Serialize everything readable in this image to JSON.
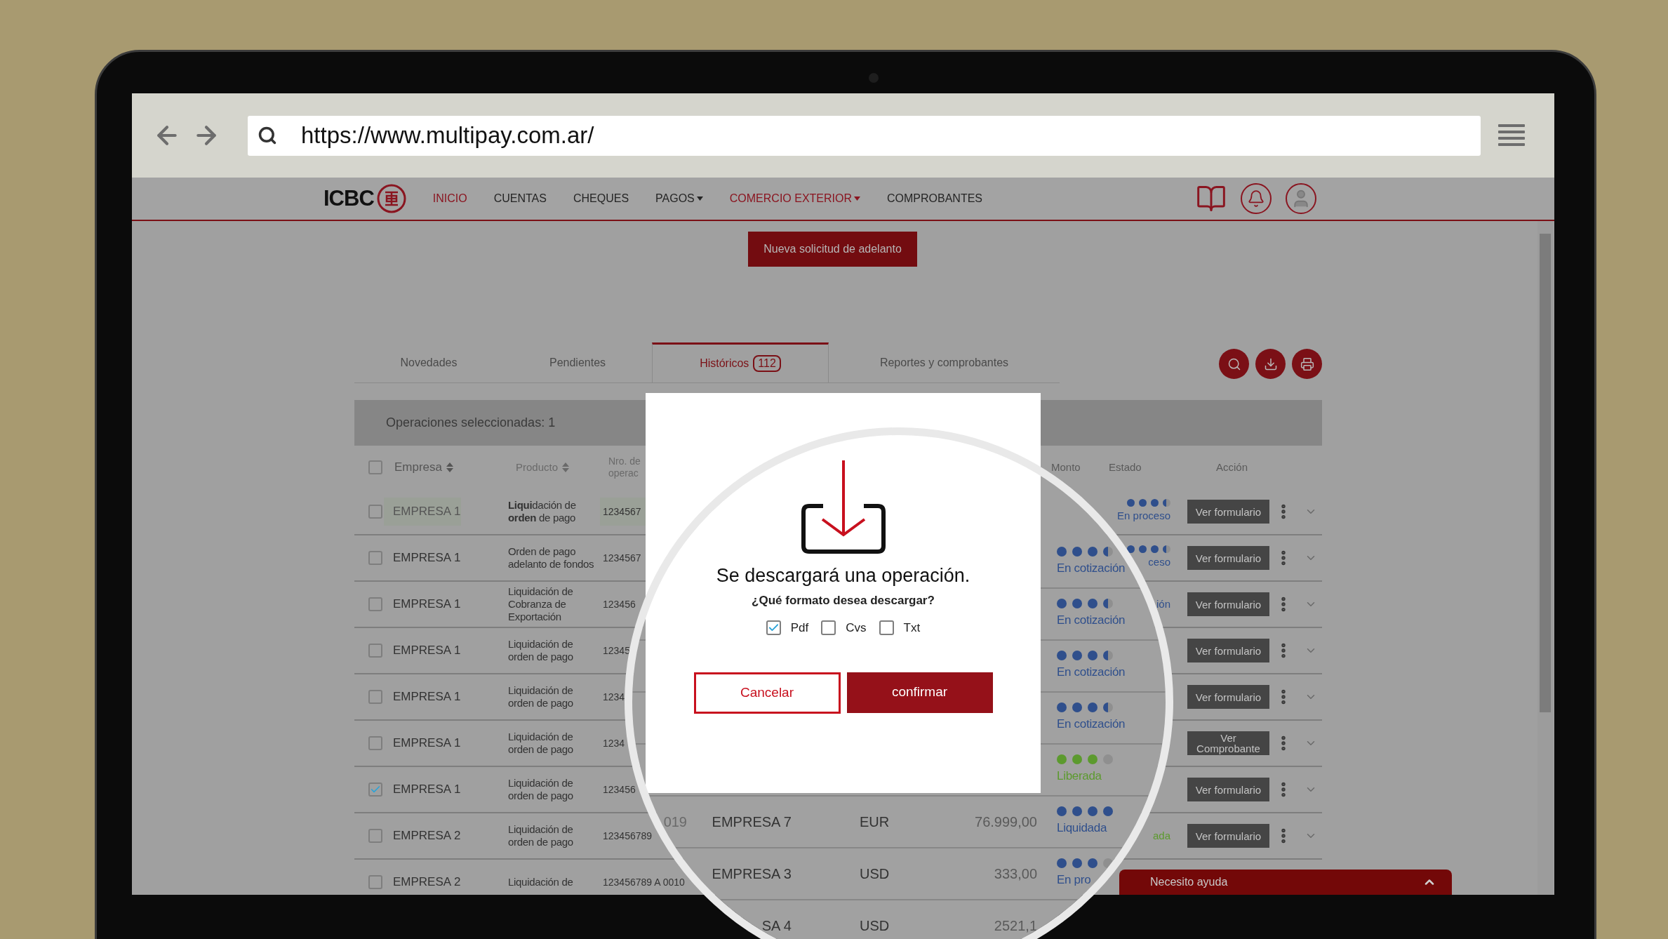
{
  "browser": {
    "url": "https://www.multipay.com.ar/"
  },
  "nav": {
    "logo": "ICBC",
    "items": [
      {
        "label": "INICIO",
        "active": true,
        "dropdown": false
      },
      {
        "label": "CUENTAS",
        "active": false,
        "dropdown": false
      },
      {
        "label": "CHEQUES",
        "active": false,
        "dropdown": false
      },
      {
        "label": "PAGOS",
        "active": false,
        "dropdown": true
      },
      {
        "label": "COMERCIO EXTERIOR",
        "active": true,
        "dropdown": true
      },
      {
        "label": "COMPROBANTES",
        "active": false,
        "dropdown": false
      }
    ]
  },
  "primary_button": "Nueva solicitud de adelanto",
  "tabs": [
    {
      "label": "Novedades",
      "selected": false
    },
    {
      "label": "Pendientes",
      "selected": false
    },
    {
      "label": "Históricos",
      "badge": "112",
      "selected": true
    },
    {
      "label": "Reportes y comprobantes",
      "selected": false
    }
  ],
  "selection_bar": "Operaciones seleccionadas: 1",
  "table": {
    "header_checked": false,
    "columns": [
      {
        "label": "Empresa",
        "sortable": true,
        "kind": "company"
      },
      {
        "label": "Producto",
        "sortable": true,
        "kind": "product"
      },
      {
        "label": "Nro. de operac",
        "sortable": false,
        "kind": "number"
      },
      {
        "label": "Monto",
        "sortable": false,
        "kind": "amount"
      },
      {
        "label": "Estado",
        "sortable": false,
        "kind": "status"
      },
      {
        "label": "Acción",
        "sortable": false,
        "kind": "action"
      }
    ],
    "rows": [
      {
        "checked": false,
        "highlighted": true,
        "company": "EMPRESA 1",
        "product": "**Liqui**dación de **orden** de pago",
        "number": "1234567",
        "status": {
          "label": "En proceso",
          "color": "#2f4f8c",
          "stars": 3,
          "partial": true
        },
        "action": "Ver formulario"
      },
      {
        "checked": false,
        "highlighted": false,
        "company": "EMPRESA 1",
        "product": "Orden de pago adelanto de fondos",
        "number": "1234567",
        "status": {
          "label": "ceso",
          "color": "#2f4f8c",
          "stars": 3,
          "partial": true
        },
        "action": "Ver formulario"
      },
      {
        "checked": false,
        "highlighted": false,
        "company": "EMPRESA 1",
        "product": "Liquidación de Cobranza de Exportación",
        "number": "123456",
        "status": {
          "label": "ión",
          "color": "#2f4f8c"
        },
        "action": "Ver formulario"
      },
      {
        "checked": false,
        "highlighted": false,
        "company": "EMPRESA 1",
        "product": "Liquidación de orden de pago",
        "number": "12345",
        "action": "Ver formulario"
      },
      {
        "checked": false,
        "highlighted": false,
        "company": "EMPRESA 1",
        "product": "Liquidación de orden de pago",
        "number": "1234",
        "action": "Ver formulario"
      },
      {
        "checked": false,
        "highlighted": false,
        "company": "EMPRESA 1",
        "product": "Liquidación de orden de pago",
        "number": "1234",
        "action": "Ver Comprobante"
      },
      {
        "checked": true,
        "highlighted": false,
        "company": "EMPRESA 1",
        "product": "Liquidación de orden de pago",
        "number": "123456",
        "action": "Ver formulario"
      },
      {
        "checked": false,
        "highlighted": false,
        "company": "EMPRESA 2",
        "product": "Liquidación de orden de pago",
        "number": "123456789",
        "status": {
          "label": "ada",
          "color": "#5c9a2e"
        },
        "action": "Ver formulario"
      },
      {
        "checked": false,
        "highlighted": false,
        "company": "EMPRESA 2",
        "product": "Liquidación de",
        "number": "123456789 A 0010"
      }
    ]
  },
  "magnifier": {
    "rows": [
      {
        "status": {
          "label": "En cotización",
          "color": "#2f4f8c",
          "stars": 3,
          "partial": true
        }
      },
      {
        "status": {
          "label": "En cotización",
          "color": "#2f4f8c",
          "stars": 3,
          "partial": true
        }
      },
      {
        "status": {
          "label": "En cotización",
          "color": "#2f4f8c",
          "stars": 3,
          "partial": true
        }
      },
      {
        "status": {
          "label": "En cotización",
          "color": "#2f4f8c",
          "stars": 3,
          "partial": true
        }
      },
      {
        "status": {
          "label": "Liberada",
          "color": "#5c9a2e",
          "stars": 3
        }
      },
      {
        "date": "019",
        "company": "EMPRESA 7",
        "currency": "EUR",
        "amount": "76.999,00",
        "status": {
          "label": "Liquidada",
          "color": "#2f4f8c",
          "stars": 4
        }
      },
      {
        "company": "EMPRESA 3",
        "currency": "USD",
        "amount": "333,00",
        "status": {
          "label": "En pro",
          "color": "#2f4f8c",
          "stars": 3
        }
      },
      {
        "company": "SA 4",
        "currency": "USD",
        "amount": "2521,1"
      }
    ]
  },
  "modal": {
    "title": "Se descargará una operación.",
    "question": "¿Qué formato desea descargar?",
    "formats": [
      {
        "label": "Pdf",
        "checked": true
      },
      {
        "label": "Cvs",
        "checked": false
      },
      {
        "label": "Txt",
        "checked": false
      }
    ],
    "cancel": "Cancelar",
    "confirm": "confirmar"
  },
  "help_bar": {
    "label": "Necesito ayuda",
    "expanded": false
  }
}
